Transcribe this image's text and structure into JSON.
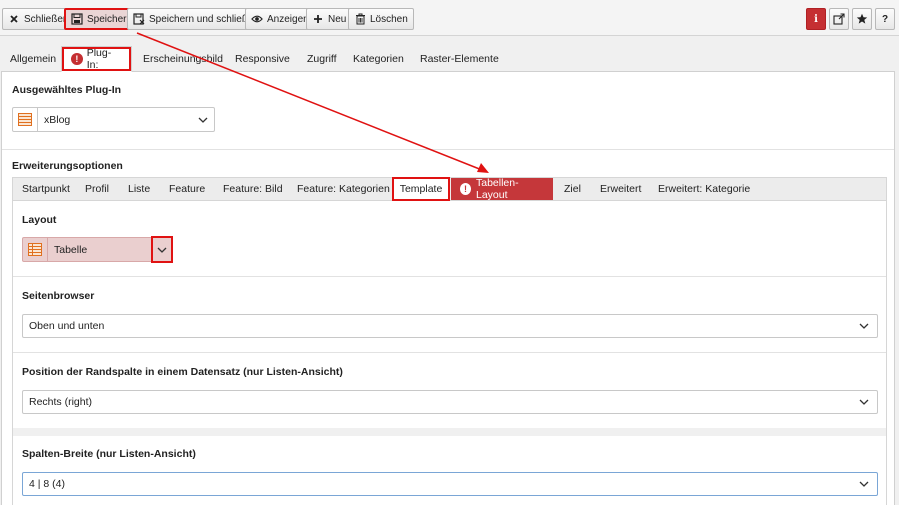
{
  "toolbar": {
    "close_label": "Schließen",
    "save_label": "Speichern",
    "save_close_label": "Speichern und schließen",
    "view_label": "Anzeigen",
    "new_label": "Neu",
    "delete_label": "Löschen",
    "info_label": "i",
    "help_label": "?"
  },
  "main_tabs": [
    {
      "label": "Allgemein"
    },
    {
      "label": "Plug-In:"
    },
    {
      "label": "Erscheinungsbild"
    },
    {
      "label": "Responsive"
    },
    {
      "label": "Zugriff"
    },
    {
      "label": "Kategorien"
    },
    {
      "label": "Raster-Elemente"
    }
  ],
  "plugin_section": {
    "title": "Ausgewähltes Plug-In",
    "selected": "xBlog"
  },
  "extension_section": {
    "title": "Erweiterungsoptionen"
  },
  "sub_tabs": [
    {
      "label": "Startpunkt"
    },
    {
      "label": "Profil"
    },
    {
      "label": "Liste"
    },
    {
      "label": "Feature"
    },
    {
      "label": "Feature: Bild"
    },
    {
      "label": "Feature: Kategorien"
    },
    {
      "label": "Template"
    },
    {
      "label": "Tabellen-Layout"
    },
    {
      "label": "Ziel"
    },
    {
      "label": "Erweitert"
    },
    {
      "label": "Erweitert: Kategorie"
    }
  ],
  "fields": {
    "layout": {
      "label": "Layout",
      "value": "Tabelle"
    },
    "page_browser": {
      "label": "Seitenbrowser",
      "value": "Oben und unten"
    },
    "sidebar_position": {
      "label": "Position der Randspalte in einem Datensatz (nur Listen-Ansicht)",
      "value": "Rechts (right)"
    },
    "column_width": {
      "label": "Spalten-Breite (nur Listen-Ansicht)",
      "value": "4 | 8 (4)"
    }
  },
  "colors": {
    "accent": "#c52f32",
    "highlight": "#e01212"
  }
}
